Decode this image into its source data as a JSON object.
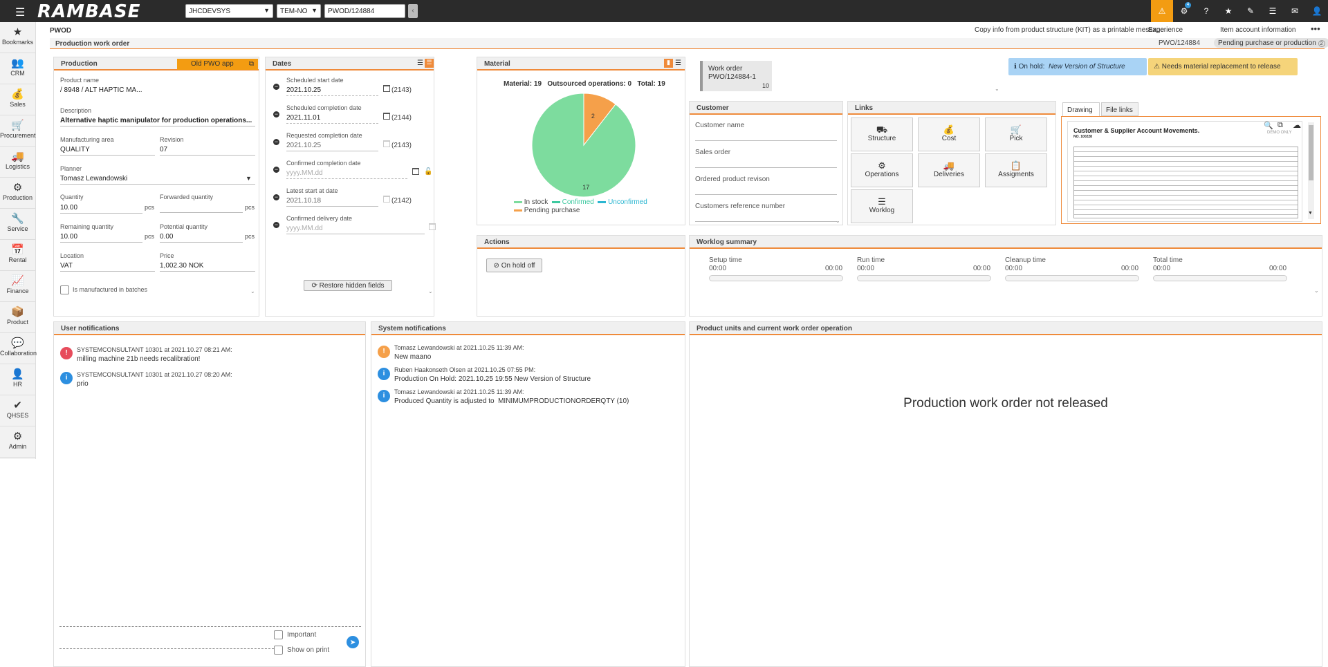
{
  "topbar": {
    "brand": "RAMBASE",
    "database": "JHCDEVSYS",
    "company": "TEM-NO",
    "search_value": "PWOD/124884",
    "notification_count": "4"
  },
  "sidebar": {
    "items": [
      {
        "label": "Bookmarks",
        "icon": "★"
      },
      {
        "label": "CRM",
        "icon": "👥"
      },
      {
        "label": "Sales",
        "icon": "💰"
      },
      {
        "label": "Procurement",
        "icon": "🛒"
      },
      {
        "label": "Logistics",
        "icon": "🚚"
      },
      {
        "label": "Production",
        "icon": "⚙"
      },
      {
        "label": "Service",
        "icon": "🔧"
      },
      {
        "label": "Rental",
        "icon": "📅"
      },
      {
        "label": "Finance",
        "icon": "📈"
      },
      {
        "label": "Product",
        "icon": "📦"
      },
      {
        "label": "Collaboration",
        "icon": "💬"
      },
      {
        "label": "HR",
        "icon": "👤"
      },
      {
        "label": "QHSES",
        "icon": "✔"
      },
      {
        "label": "Admin",
        "icon": "⚙"
      }
    ]
  },
  "page": {
    "code": "PWOD",
    "title": "Production work order",
    "menu": [
      "Copy info from product structure (KIT) as a printable message",
      "Experience",
      "Item account information"
    ],
    "doc_id": "PWO/124884",
    "status": "Pending purchase or production",
    "status_num": "2"
  },
  "production": {
    "title": "Production",
    "old_app_button": "Old PWO app",
    "product_name_label": "Product name",
    "product_name": "/ 8948 / ALT HAPTIC MA...",
    "description_label": "Description",
    "description": "Alternative haptic manipulator for production operations...",
    "manufacturing_area_label": "Manufacturing area",
    "manufacturing_area": "QUALITY",
    "revision_label": "Revision",
    "revision": "07",
    "planner_label": "Planner",
    "planner": "Tomasz Lewandowski",
    "quantity_label": "Quantity",
    "quantity": "10.00",
    "forwarded_quantity_label": "Forwarded quantity",
    "forwarded_quantity": "",
    "remaining_quantity_label": "Remaining quantity",
    "remaining_quantity": "10.00",
    "potential_quantity_label": "Potential quantity",
    "potential_quantity": "0.00",
    "unit": "pcs",
    "location_label": "Location",
    "location": "VAT",
    "price_label": "Price",
    "price": "1,002.30 NOK",
    "batches_label": "Is manufactured in batches"
  },
  "dates": {
    "title": "Dates",
    "rows": [
      {
        "label": "Scheduled start date",
        "value": "2021.10.25",
        "week": "(2143)"
      },
      {
        "label": "Scheduled completion date",
        "value": "2021.11.01",
        "week": "(2144)"
      },
      {
        "label": "Requested completion date",
        "value": "2021.10.25",
        "week": "(2143)"
      },
      {
        "label": "Confirmed completion date",
        "value": "yyyy.MM.dd",
        "week": ""
      },
      {
        "label": "Latest start at date",
        "value": "2021.10.18",
        "week": "(2142)"
      },
      {
        "label": "Confirmed delivery date",
        "value": "yyyy.MM.dd",
        "week": ""
      }
    ],
    "restore_button": "Restore hidden fields"
  },
  "material": {
    "title": "Material",
    "summary": "Material: 19   Outsourced operations: 0   Total: 19",
    "legend": [
      "In stock",
      "Confirmed",
      "Unconfirmed",
      "Pending purchase"
    ],
    "colors": {
      "in_stock": "#7ddc9e",
      "confirmed": "#3ec9a0",
      "unconfirmed": "#2bb6d1",
      "pending": "#f5a04a"
    }
  },
  "chart_data": {
    "type": "pie",
    "categories": [
      "In stock",
      "Pending purchase"
    ],
    "values": [
      17,
      2
    ],
    "title": "",
    "legend": [
      "In stock",
      "Confirmed",
      "Unconfirmed",
      "Pending purchase"
    ]
  },
  "work_order": {
    "label": "Work order",
    "id": "PWO/124884-1",
    "qty": "10"
  },
  "alerts": {
    "on_hold_prefix": "On hold:",
    "on_hold_reason": "New Version of Structure",
    "material_warning": "Needs material replacement to release"
  },
  "customer": {
    "title": "Customer",
    "fields": [
      "Customer name",
      "Sales order",
      "Ordered product revison",
      "Customers reference number"
    ]
  },
  "links": {
    "title": "Links",
    "buttons": [
      {
        "label": "Structure",
        "icon": "⛟"
      },
      {
        "label": "Cost",
        "icon": "💰"
      },
      {
        "label": "Pick",
        "icon": "🛒"
      },
      {
        "label": "Operations",
        "icon": "⚙"
      },
      {
        "label": "Deliveries",
        "icon": "🚚"
      },
      {
        "label": "Assigments",
        "icon": "📋"
      },
      {
        "label": "Worklog",
        "icon": "☰"
      }
    ]
  },
  "drawing": {
    "tabs": [
      "Drawing",
      "File links"
    ],
    "doc_title": "Customer & Supplier Account Movements.",
    "doc_sub": "NO. 100228",
    "demo": "DEMO ONLY"
  },
  "actions": {
    "title": "Actions",
    "on_hold_off": "On hold off"
  },
  "worklog": {
    "title": "Worklog summary",
    "items": [
      {
        "label": "Setup time",
        "start": "00:00",
        "end": "00:00"
      },
      {
        "label": "Run time",
        "start": "00:00",
        "end": "00:00"
      },
      {
        "label": "Cleanup time",
        "start": "00:00",
        "end": "00:00"
      },
      {
        "label": "Total time",
        "start": "00:00",
        "end": "00:00"
      }
    ]
  },
  "user_notifications": {
    "title": "User notifications",
    "items": [
      {
        "who": "SYSTEMCONSULTANT 10301 at 2021.10.27 08:21 AM:",
        "msg": "milling machine 21b needs recalibration!",
        "type": "error"
      },
      {
        "who": "SYSTEMCONSULTANT 10301 at 2021.10.27 08:20 AM:",
        "msg": "prio",
        "type": "info"
      }
    ],
    "important_label": "Important",
    "show_on_print_label": "Show on print"
  },
  "system_notifications": {
    "title": "System notifications",
    "items": [
      {
        "who": "Tomasz Lewandowski at 2021.10.25 11:39 AM:",
        "msg": "New maano",
        "type": "warn"
      },
      {
        "who": "Ruben Haakonseth Olsen at 2021.10.25 07:55 PM:",
        "msg": "Production On Hold: 2021.10.25 19:55 New Version of Structure",
        "type": "info"
      },
      {
        "who": "Tomasz Lewandowski at 2021.10.25 11:39 AM:",
        "msg": "Produced Quantity is adjusted to  MINIMUMPRODUCTIONORDERQTY (10)",
        "type": "info"
      }
    ]
  },
  "product_units": {
    "title": "Product units and current work order operation",
    "empty_message": "Production work order not released"
  }
}
